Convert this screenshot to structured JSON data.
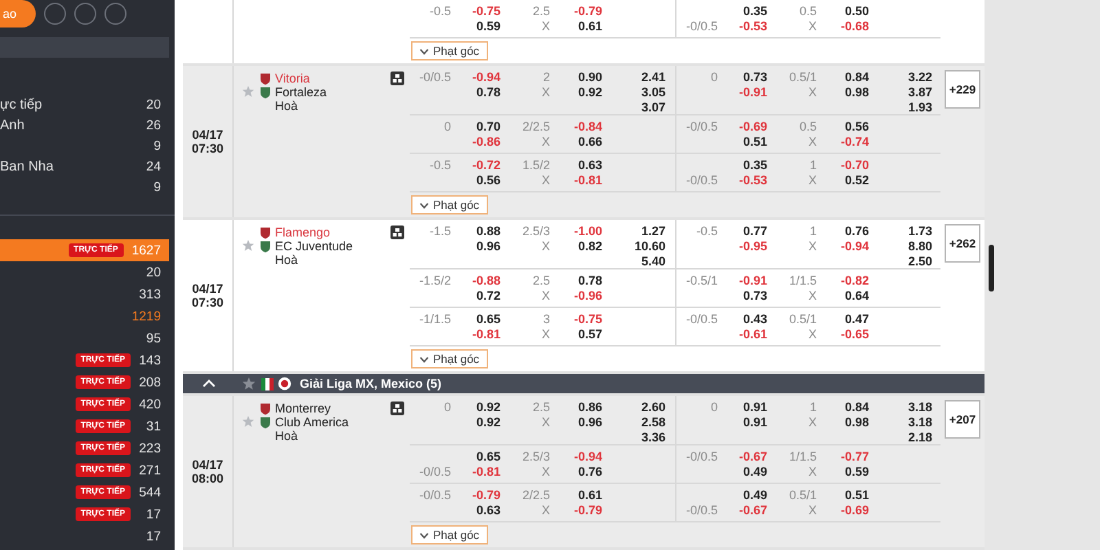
{
  "sidebar": {
    "top_tab": "ao",
    "sections": [
      {
        "items": [
          {
            "label": "ực tiếp",
            "count": "20",
            "selected": false,
            "highlighted": false
          },
          {
            "label": "Anh",
            "count": "26",
            "selected": false,
            "highlighted": false
          },
          {
            "count": "9",
            "selected": false,
            "highlighted": false
          },
          {
            "label": "Ban Nha",
            "count": "24",
            "selected": false,
            "highlighted": false
          },
          {
            "count": "9",
            "selected": false,
            "highlighted": false
          }
        ]
      },
      {
        "items": [
          {
            "badge": "TRỰC TIẾP",
            "count": "1627",
            "selected": true,
            "highlighted": false
          },
          {
            "count": "20",
            "selected": false,
            "highlighted": false
          },
          {
            "count": "313",
            "selected": false,
            "highlighted": false
          },
          {
            "count": "1219",
            "selected": false,
            "highlighted": true
          },
          {
            "count": "95",
            "selected": false,
            "highlighted": false
          },
          {
            "badge": "TRỰC TIẾP",
            "count": "143",
            "selected": false,
            "highlighted": false
          },
          {
            "badge": "TRỰC TIẾP",
            "count": "208",
            "selected": false,
            "highlighted": false
          },
          {
            "badge": "TRỰC TIẾP",
            "count": "420",
            "selected": false,
            "highlighted": false
          },
          {
            "badge": "TRỰC TIẾP",
            "count": "31",
            "selected": false,
            "highlighted": false
          },
          {
            "badge": "TRỰC TIẾP",
            "count": "223",
            "selected": false,
            "highlighted": false
          },
          {
            "badge": "TRỰC TIẾP",
            "count": "271",
            "selected": false,
            "highlighted": false
          },
          {
            "badge": "TRỰC TIẾP",
            "count": "544",
            "selected": false,
            "highlighted": false
          },
          {
            "badge": "TRỰC TIẾP",
            "count": "17",
            "selected": false,
            "highlighted": false
          },
          {
            "count": "17",
            "selected": false,
            "highlighted": false
          }
        ]
      }
    ]
  },
  "blocks": [
    {
      "kind": "match",
      "corner_button": "Phạt góc",
      "markets": [
        {
          "ft": {
            "hdp_home": "-0.5",
            "hdp_odds": [
              "-0.75",
              "0.59"
            ],
            "ou": [
              "2.5",
              "X"
            ],
            "ou_odds": [
              "-0.79",
              "0.61"
            ]
          },
          "h1": {
            "hdp_away": "-0/0.5",
            "hdp_odds": [
              "0.35",
              "-0.53"
            ],
            "ou": [
              "0.5",
              "X"
            ],
            "ou_odds": [
              "0.50",
              "-0.68"
            ]
          }
        }
      ]
    },
    {
      "kind": "match",
      "date": "04/17",
      "time": "07:30",
      "home": {
        "name": "Vitoria",
        "favorite": true
      },
      "away": {
        "name": "Fortaleza",
        "favorite": false
      },
      "draw": "Hoà",
      "more": "+229",
      "corner_button": "Phạt góc",
      "markets": [
        {
          "ft": {
            "hdp_home": "-0/0.5",
            "hdp_odds": [
              "-0.94",
              "0.78"
            ],
            "ou": [
              "2",
              "X"
            ],
            "ou_odds": [
              "0.90",
              "0.92"
            ],
            "x12": [
              "2.41",
              "3.05",
              "3.07"
            ]
          },
          "h1": {
            "hdp_home": "0",
            "hdp_odds": [
              "0.73",
              "-0.91"
            ],
            "ou": [
              "0.5/1",
              "X"
            ],
            "ou_odds": [
              "0.84",
              "0.98"
            ],
            "x12": [
              "3.22",
              "3.87",
              "1.93"
            ]
          }
        },
        {
          "ft": {
            "hdp_home": "0",
            "hdp_odds": [
              "0.70",
              "-0.86"
            ],
            "ou": [
              "2/2.5",
              "X"
            ],
            "ou_odds": [
              "-0.84",
              "0.66"
            ]
          },
          "h1": {
            "hdp_home": "-0/0.5",
            "hdp_odds": [
              "-0.69",
              "0.51"
            ],
            "ou": [
              "0.5",
              "X"
            ],
            "ou_odds": [
              "0.56",
              "-0.74"
            ]
          }
        },
        {
          "ft": {
            "hdp_home": "-0.5",
            "hdp_odds": [
              "-0.72",
              "0.56"
            ],
            "ou": [
              "1.5/2",
              "X"
            ],
            "ou_odds": [
              "0.63",
              "-0.81"
            ]
          },
          "h1": {
            "hdp_away": "-0/0.5",
            "hdp_odds": [
              "0.35",
              "-0.53"
            ],
            "ou": [
              "1",
              "X"
            ],
            "ou_odds": [
              "-0.70",
              "0.52"
            ]
          }
        }
      ]
    },
    {
      "kind": "match",
      "date": "04/17",
      "time": "07:30",
      "home": {
        "name": "Flamengo",
        "favorite": true
      },
      "away": {
        "name": "EC Juventude",
        "favorite": false
      },
      "draw": "Hoà",
      "more": "+262",
      "corner_button": "Phạt góc",
      "markets": [
        {
          "ft": {
            "hdp_home": "-1.5",
            "hdp_odds": [
              "0.88",
              "0.96"
            ],
            "ou": [
              "2.5/3",
              "X"
            ],
            "ou_odds": [
              "-1.00",
              "0.82"
            ],
            "x12": [
              "1.27",
              "10.60",
              "5.40"
            ]
          },
          "h1": {
            "hdp_home": "-0.5",
            "hdp_odds": [
              "0.77",
              "-0.95"
            ],
            "ou": [
              "1",
              "X"
            ],
            "ou_odds": [
              "0.76",
              "-0.94"
            ],
            "x12": [
              "1.73",
              "8.80",
              "2.50"
            ]
          }
        },
        {
          "ft": {
            "hdp_home": "-1.5/2",
            "hdp_odds": [
              "-0.88",
              "0.72"
            ],
            "ou": [
              "2.5",
              "X"
            ],
            "ou_odds": [
              "0.78",
              "-0.96"
            ]
          },
          "h1": {
            "hdp_home": "-0.5/1",
            "hdp_odds": [
              "-0.91",
              "0.73"
            ],
            "ou": [
              "1/1.5",
              "X"
            ],
            "ou_odds": [
              "-0.82",
              "0.64"
            ]
          }
        },
        {
          "ft": {
            "hdp_home": "-1/1.5",
            "hdp_odds": [
              "0.65",
              "-0.81"
            ],
            "ou": [
              "3",
              "X"
            ],
            "ou_odds": [
              "-0.75",
              "0.57"
            ]
          },
          "h1": {
            "hdp_home": "-0/0.5",
            "hdp_odds": [
              "0.43",
              "-0.61"
            ],
            "ou": [
              "0.5/1",
              "X"
            ],
            "ou_odds": [
              "0.47",
              "-0.65"
            ]
          }
        }
      ]
    },
    {
      "kind": "league",
      "title": "Giải Liga MX, Mexico (5)",
      "expanded": true
    },
    {
      "kind": "match",
      "date": "04/17",
      "time": "08:00",
      "home": {
        "name": "Monterrey",
        "favorite": false
      },
      "away": {
        "name": "Club America",
        "favorite": false
      },
      "draw": "Hoà",
      "more": "+207",
      "corner_button": "Phạt góc",
      "markets": [
        {
          "ft": {
            "hdp_home": "0",
            "hdp_odds": [
              "0.92",
              "0.92"
            ],
            "ou": [
              "2.5",
              "X"
            ],
            "ou_odds": [
              "0.86",
              "0.96"
            ],
            "x12": [
              "2.60",
              "2.58",
              "3.36"
            ]
          },
          "h1": {
            "hdp_home": "0",
            "hdp_odds": [
              "0.91",
              "0.91"
            ],
            "ou": [
              "1",
              "X"
            ],
            "ou_odds": [
              "0.84",
              "0.98"
            ],
            "x12": [
              "3.18",
              "3.18",
              "2.18"
            ]
          }
        },
        {
          "ft": {
            "hdp_away": "-0/0.5",
            "hdp_odds": [
              "0.65",
              "-0.81"
            ],
            "ou": [
              "2.5/3",
              "X"
            ],
            "ou_odds": [
              "-0.94",
              "0.76"
            ]
          },
          "h1": {
            "hdp_home": "-0/0.5",
            "hdp_odds": [
              "-0.67",
              "0.49"
            ],
            "ou": [
              "1/1.5",
              "X"
            ],
            "ou_odds": [
              "-0.77",
              "0.59"
            ]
          }
        },
        {
          "ft": {
            "hdp_home": "-0/0.5",
            "hdp_odds": [
              "-0.79",
              "0.63"
            ],
            "ou": [
              "2/2.5",
              "X"
            ],
            "ou_odds": [
              "0.61",
              "-0.79"
            ]
          },
          "h1": {
            "hdp_away": "-0/0.5",
            "hdp_odds": [
              "0.49",
              "-0.67"
            ],
            "ou": [
              "0.5/1",
              "X"
            ],
            "ou_odds": [
              "0.51",
              "-0.69"
            ]
          }
        }
      ]
    }
  ]
}
